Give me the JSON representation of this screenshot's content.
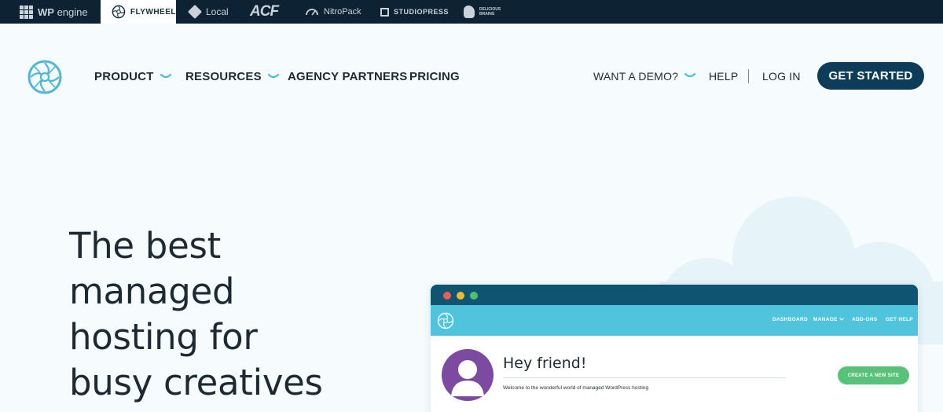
{
  "brand_bar": {
    "wpengine": {
      "bold": "WP",
      "light": "engine"
    },
    "flywheel": "FLYWHEEL",
    "local": "Local",
    "acf": "ACF",
    "nitropack": "NitroPack",
    "studiopress": "STUDIOPRESS",
    "delicious_brains": {
      "line1": "DELICIOUS",
      "line2": "BRAINS"
    }
  },
  "nav": {
    "product": "PRODUCT",
    "resources": "RESOURCES",
    "agency_partners": "AGENCY PARTNERS",
    "pricing": "PRICING",
    "want_demo": "WANT A DEMO?",
    "help": "HELP",
    "login": "LOG IN",
    "get_started": "GET STARTED"
  },
  "hero": {
    "lines": [
      "The best",
      "managed",
      "hosting for",
      "busy creatives"
    ]
  },
  "dashboard_mock": {
    "nav": {
      "dashboard": "DASHBOARD",
      "manage": "MANAGE",
      "addons": "ADD-ONS",
      "get_help": "GET HELP"
    },
    "greeting": "Hey friend!",
    "welcome": "Welcome to the wonderful world of managed WordPress hosting",
    "create_site": "CREATE A NEW SITE"
  },
  "colors": {
    "brand_bar_bg": "#0d2232",
    "primary_button": "#0c3c5a",
    "accent_teal": "#4fc4dc",
    "chevron": "#4fb8d4",
    "create_button": "#59c27a",
    "avatar": "#7c4aa0",
    "page_bg": "#f6fbfd"
  }
}
